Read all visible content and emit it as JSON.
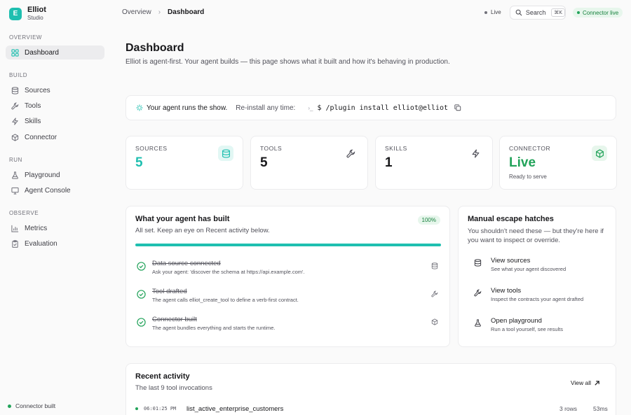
{
  "brand": {
    "logo_letter": "E",
    "name": "Elliot",
    "subtitle": "Studio"
  },
  "sidebar": {
    "sections": [
      {
        "label": "OVERVIEW"
      },
      {
        "label": "BUILD"
      },
      {
        "label": "RUN"
      },
      {
        "label": "OBSERVE"
      }
    ],
    "items": [
      {
        "label": "Dashboard",
        "icon": "dashboard-icon",
        "active": true
      },
      {
        "label": "Sources",
        "icon": "database-icon"
      },
      {
        "label": "Tools",
        "icon": "wrench-icon"
      },
      {
        "label": "Skills",
        "icon": "bolt-icon"
      },
      {
        "label": "Connector",
        "icon": "cube-icon"
      },
      {
        "label": "Playground",
        "icon": "flask-icon"
      },
      {
        "label": "Agent Console",
        "icon": "console-icon"
      },
      {
        "label": "Metrics",
        "icon": "bar-chart-icon"
      },
      {
        "label": "Evaluation",
        "icon": "clipboard-check-icon"
      }
    ],
    "footer_status": "Connector built"
  },
  "topbar": {
    "breadcrumb": {
      "parent": "Overview",
      "separator": "›",
      "current": "Dashboard"
    },
    "live_label": "Live",
    "search_label": "Search",
    "search_shortcut": "⌘K",
    "connector_status": "Connector live"
  },
  "page": {
    "title": "Dashboard",
    "lede": "Elliot is agent-first. Your agent builds — this page shows what it built and how it's behaving in production."
  },
  "install_strip": {
    "headline": "Your agent runs the show.",
    "reinstall_label": "Re-install any time:",
    "prompt_glyph": "›_",
    "command": "$ /plugin install elliot@elliot"
  },
  "stats": [
    {
      "label": "SOURCES",
      "value": "5",
      "icon": "database-icon",
      "tone": "teal"
    },
    {
      "label": "TOOLS",
      "value": "5",
      "icon": "wrench-icon",
      "tone": "plain"
    },
    {
      "label": "SKILLS",
      "value": "1",
      "icon": "bolt-icon",
      "tone": "plain"
    },
    {
      "label": "CONNECTOR",
      "value": "Live",
      "sub": "Ready to serve",
      "icon": "cube-icon",
      "tone": "green"
    }
  ],
  "built": {
    "title": "What your agent has built",
    "subtitle": "All set. Keep an eye on Recent activity below.",
    "percent_label": "100%",
    "progress": 1.0,
    "steps": [
      {
        "title": "Data source connected",
        "detail": "Ask your agent: 'discover the schema at https://api.example.com'.",
        "icon": "database-icon"
      },
      {
        "title": "Tool drafted",
        "detail": "The agent calls elliot_create_tool to define a verb-first contract.",
        "icon": "wrench-icon"
      },
      {
        "title": "Connector built",
        "detail": "The agent bundles everything and starts the runtime.",
        "icon": "cube-icon"
      }
    ]
  },
  "manual": {
    "title": "Manual escape hatches",
    "subtitle": "You shouldn't need these — but they're here if you want to inspect or override.",
    "items": [
      {
        "title": "View sources",
        "detail": "See what your agent discovered",
        "icon": "database-icon"
      },
      {
        "title": "View tools",
        "detail": "Inspect the contracts your agent drafted",
        "icon": "wrench-icon"
      },
      {
        "title": "Open playground",
        "detail": "Run a tool yourself, see results",
        "icon": "flask-icon"
      }
    ]
  },
  "recent": {
    "title": "Recent activity",
    "subtitle": "The last 9 tool invocations",
    "view_all": "View all",
    "rows": [
      {
        "time": "06:01:25 PM",
        "tool": "list_active_enterprise_customers",
        "rows": "3 rows",
        "duration": "53ms"
      }
    ]
  },
  "colors": {
    "accent": "#1fbfb0",
    "success": "#22a35a"
  }
}
